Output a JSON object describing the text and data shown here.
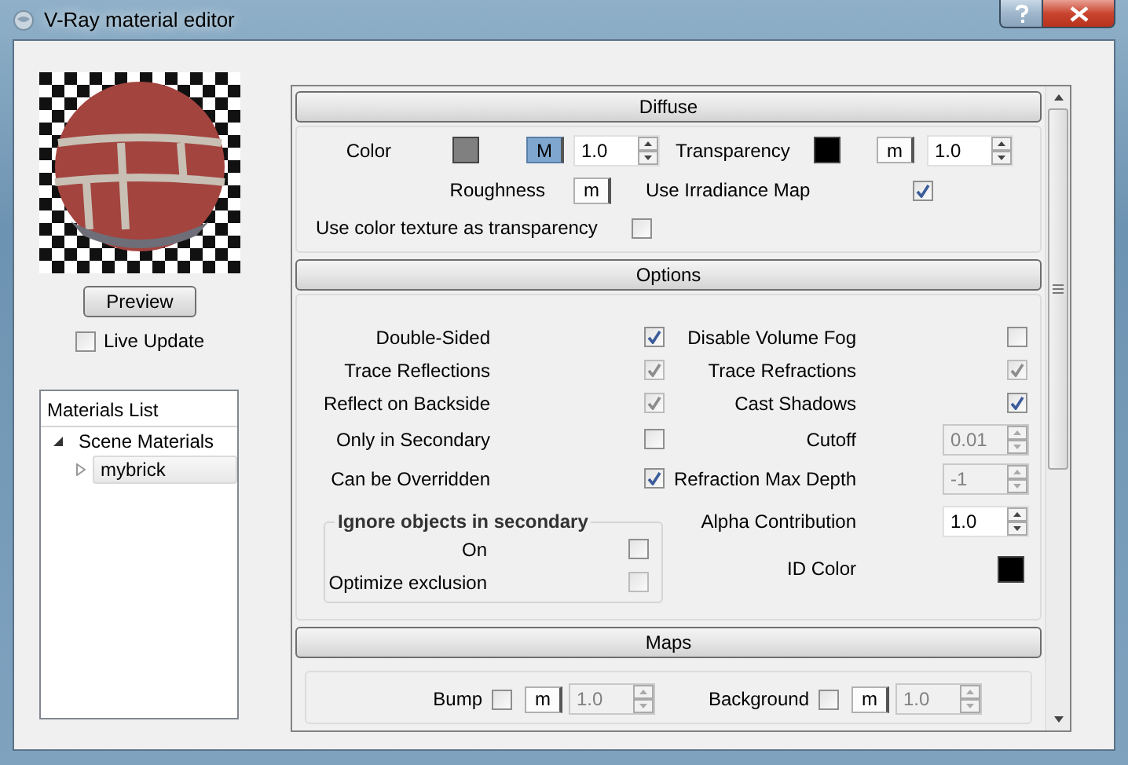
{
  "window": {
    "title": "V-Ray material editor"
  },
  "preview": {
    "button": "Preview",
    "live_update": {
      "label": "Live Update",
      "checked": false
    }
  },
  "materials_list": {
    "title": "Materials List",
    "tree": [
      {
        "label": "Scene Materials",
        "expanded": true,
        "selected": false,
        "children": [
          {
            "label": "mybrick",
            "expanded": false,
            "selected": true
          }
        ]
      }
    ]
  },
  "diffuse": {
    "title": "Diffuse",
    "color": {
      "label": "Color",
      "color": "#808080",
      "map": {
        "label": "M",
        "active": true
      },
      "value": "1.0"
    },
    "transparency": {
      "label": "Transparency",
      "color": "#000000",
      "map": {
        "label": "m",
        "active": false
      },
      "value": "1.0"
    },
    "roughness": {
      "label": "Roughness",
      "map": {
        "label": "m",
        "active": false
      }
    },
    "irradiance": {
      "label": "Use Irradiance Map",
      "checked": true
    },
    "color_texture": {
      "label": "Use color texture as transparency",
      "checked": false
    }
  },
  "options": {
    "title": "Options",
    "left": [
      {
        "label": "Double-Sided",
        "checked": true,
        "disabled": false
      },
      {
        "label": "Trace Reflections",
        "checked": true,
        "disabled": true
      },
      {
        "label": "Reflect on Backside",
        "checked": true,
        "disabled": true
      },
      {
        "label": "Only in Secondary",
        "checked": false,
        "disabled": false
      },
      {
        "label": "Can be Overridden",
        "checked": true,
        "disabled": false
      }
    ],
    "group": {
      "title": "Ignore objects in secondary",
      "items": [
        {
          "label": "On",
          "checked": false,
          "disabled": false
        },
        {
          "label": "Optimize exclusion",
          "checked": false,
          "disabled": true
        }
      ]
    },
    "right": [
      {
        "kind": "check",
        "label": "Disable Volume Fog",
        "checked": false,
        "disabled": false
      },
      {
        "kind": "check",
        "label": "Trace Refractions",
        "checked": true,
        "disabled": true
      },
      {
        "kind": "check",
        "label": "Cast Shadows",
        "checked": true,
        "disabled": false
      },
      {
        "kind": "spin",
        "label": "Cutoff",
        "value": "0.01",
        "disabled": true
      },
      {
        "kind": "spin",
        "label": "Refraction Max Depth",
        "value": "-1",
        "disabled": true
      },
      {
        "kind": "spin",
        "label": "Alpha Contribution",
        "value": "1.0",
        "disabled": false
      },
      {
        "kind": "color",
        "label": "ID Color",
        "color": "#000000"
      }
    ]
  },
  "maps": {
    "title": "Maps",
    "rows": [
      {
        "label": "Bump",
        "checked": false,
        "map": {
          "label": "m",
          "active": false
        },
        "value": "1.0",
        "disabled": true
      },
      {
        "label": "Background",
        "checked": false,
        "map": {
          "label": "m",
          "active": false
        },
        "value": "1.0",
        "disabled": true
      }
    ]
  }
}
